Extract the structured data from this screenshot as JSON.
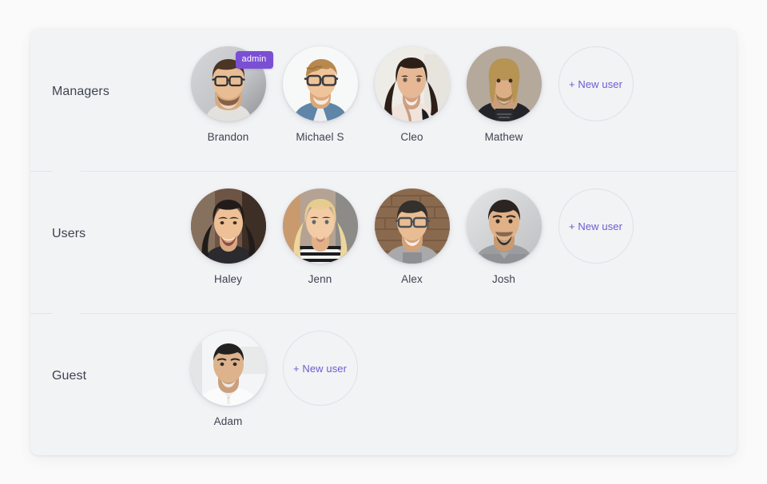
{
  "page": {
    "background_color": "#fafafa",
    "card_background_color": "#f2f3f5",
    "accent_color": "#7b4fd4",
    "link_color": "#6d5bd0"
  },
  "new_user_label": "+ New user",
  "roles": [
    {
      "label": "Managers",
      "members": [
        {
          "name": "Brandon",
          "badge": "admin",
          "avatar": "portrait-man-glasses-beard"
        },
        {
          "name": "Michael S",
          "badge": "",
          "avatar": "portrait-man-glasses-denim"
        },
        {
          "name": "Cleo",
          "badge": "",
          "avatar": "portrait-woman-dark-hair"
        },
        {
          "name": "Mathew",
          "badge": "",
          "avatar": "portrait-man-long-blond-hair"
        }
      ],
      "new_user_label": "+ New user"
    },
    {
      "label": "Users",
      "members": [
        {
          "name": "Haley",
          "badge": "",
          "avatar": "portrait-woman-asian-smiling"
        },
        {
          "name": "Jenn",
          "badge": "",
          "avatar": "portrait-woman-blonde-stripes"
        },
        {
          "name": "Alex",
          "badge": "",
          "avatar": "portrait-man-glasses-brick"
        },
        {
          "name": "Josh",
          "badge": "",
          "avatar": "portrait-man-goatee-gray"
        }
      ],
      "new_user_label": "+ New user"
    },
    {
      "label": "Guest",
      "members": [
        {
          "name": "Adam",
          "badge": "",
          "avatar": "portrait-man-white-polo"
        }
      ],
      "new_user_label": "+ New user"
    }
  ]
}
